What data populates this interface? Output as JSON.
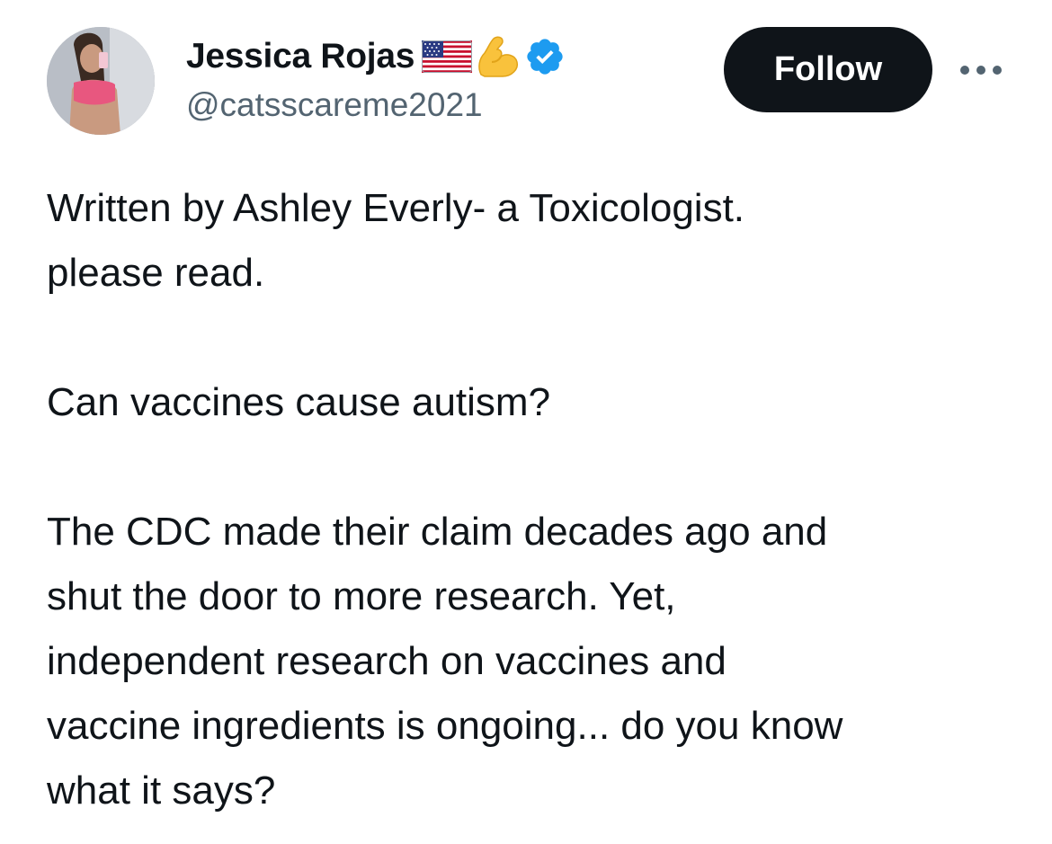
{
  "author": {
    "display_name": "Jessica Rojas",
    "handle": "@catsscareme2021",
    "avatar_icon": "profile-photo",
    "badges": [
      "us-flag-emoji",
      "flexed-biceps-emoji",
      "verified-checkmark-icon"
    ],
    "verified_color": "#1d9bf0"
  },
  "actions": {
    "follow_label": "Follow",
    "more_icon": "more-horizontal-icon"
  },
  "tweet": {
    "paragraphs": [
      {
        "lines": [
          "Written by Ashley Everly-  a Toxicologist.",
          "please read."
        ]
      },
      {
        "lines": [
          "Can vaccines cause autism?"
        ]
      },
      {
        "lines": [
          "The CDC made their claim decades ago and",
          "shut the door to more research. Yet,",
          "independent research on vaccines and",
          "vaccine ingredients is ongoing... do you know",
          "what it says?"
        ]
      }
    ]
  },
  "colors": {
    "text": "#0f1419",
    "secondary_text": "#536471",
    "follow_bg": "#0f1419",
    "follow_text": "#ffffff"
  }
}
